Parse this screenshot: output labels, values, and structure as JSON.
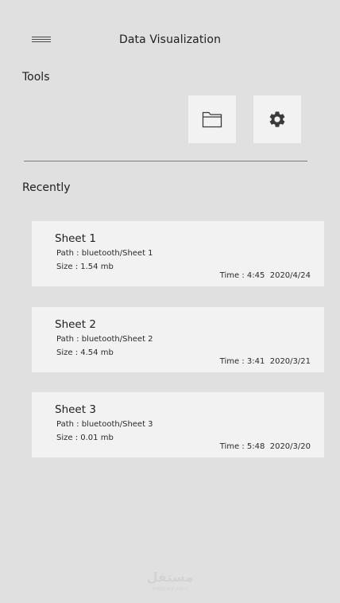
{
  "header": {
    "title": "Data Visualization",
    "menu_icon": "hamburger-menu-icon"
  },
  "tools": {
    "label": "Tools",
    "buttons": [
      {
        "icon": "folder-icon"
      },
      {
        "icon": "gear-icon"
      }
    ]
  },
  "recent": {
    "label": "Recently",
    "items": [
      {
        "name": "Sheet 1",
        "path": "Path : bluetooth/Sheet 1",
        "size": "Size : 1.54 mb",
        "time": "Time : 4:45  2020/4/24"
      },
      {
        "name": "Sheet 2",
        "path": "Path : bluetooth/Sheet 2",
        "size": "Size : 4.54 mb",
        "time": "Time : 3:41  2020/3/21"
      },
      {
        "name": "Sheet 3",
        "path": "Path : bluetooth/Sheet 3",
        "size": "Size : 0.01 mb",
        "time": "Time : 5:48  2020/3/20"
      }
    ]
  },
  "watermark": {
    "text": "مستقل",
    "sub": "mostaql.com"
  },
  "colors": {
    "background": "#e0e0e0",
    "card": "#f2f2f2",
    "text": "#1e1e1e",
    "divider": "#7a7a7a",
    "icon": "#3a3a3a"
  }
}
